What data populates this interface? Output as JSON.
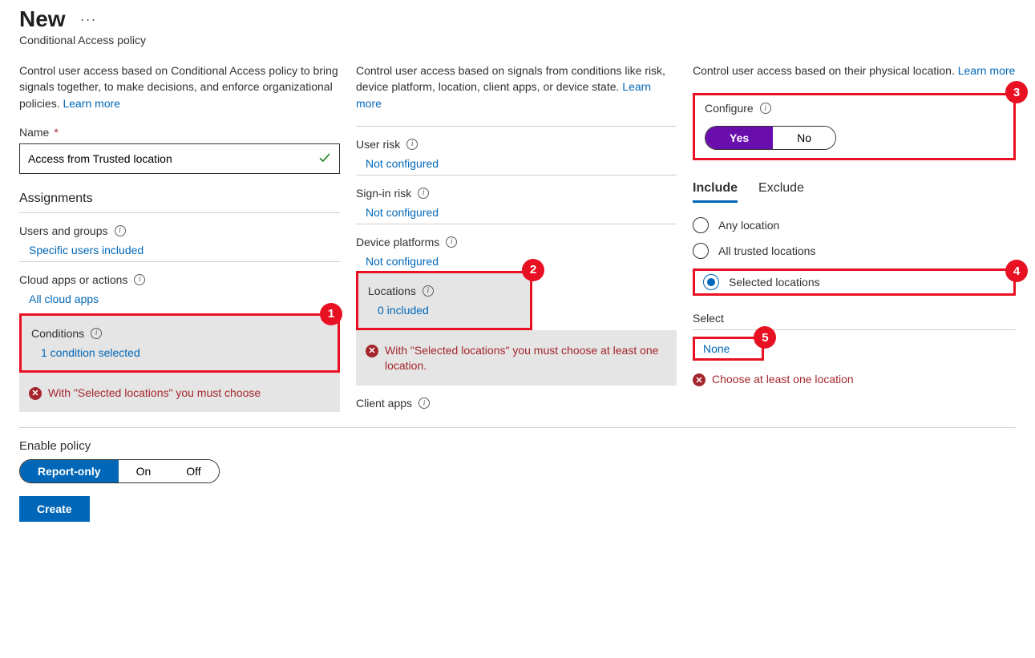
{
  "header": {
    "title": "New",
    "subtitle": "Conditional Access policy"
  },
  "col1": {
    "intro": "Control user access based on Conditional Access policy to bring signals together, to make decisions, and enforce organizational policies. ",
    "learn_more": "Learn more",
    "name_label": "Name",
    "name_value": "Access from Trusted location",
    "assignments_heading": "Assignments",
    "users_label": "Users and groups",
    "users_value": "Specific users included",
    "cloud_label": "Cloud apps or actions",
    "cloud_value": "All cloud apps",
    "conditions_label": "Conditions",
    "conditions_value": "1 condition selected",
    "conditions_error": "With \"Selected locations\" you must choose"
  },
  "footer": {
    "enable_label": "Enable policy",
    "seg_report": "Report-only",
    "seg_on": "On",
    "seg_off": "Off",
    "create": "Create"
  },
  "col2": {
    "intro": "Control user access based on signals from conditions like risk, device platform, location, client apps, or device state. ",
    "learn_more": "Learn more",
    "user_risk_label": "User risk",
    "user_risk_value": "Not configured",
    "signin_risk_label": "Sign-in risk",
    "signin_risk_value": "Not configured",
    "device_label": "Device platforms",
    "device_value": "Not configured",
    "locations_label": "Locations",
    "locations_value": "0 included",
    "locations_error": "With \"Selected locations\" you must choose at least one location.",
    "client_apps_label": "Client apps"
  },
  "col3": {
    "intro": "Control user access based on their physical location. ",
    "learn_more": "Learn more",
    "configure_label": "Configure",
    "toggle_yes": "Yes",
    "toggle_no": "No",
    "tab_include": "Include",
    "tab_exclude": "Exclude",
    "radio_any": "Any location",
    "radio_trusted": "All trusted locations",
    "radio_selected": "Selected locations",
    "select_label": "Select",
    "select_value": "None",
    "select_error": "Choose at least one location"
  },
  "callouts": {
    "c1": "1",
    "c2": "2",
    "c3": "3",
    "c4": "4",
    "c5": "5"
  }
}
